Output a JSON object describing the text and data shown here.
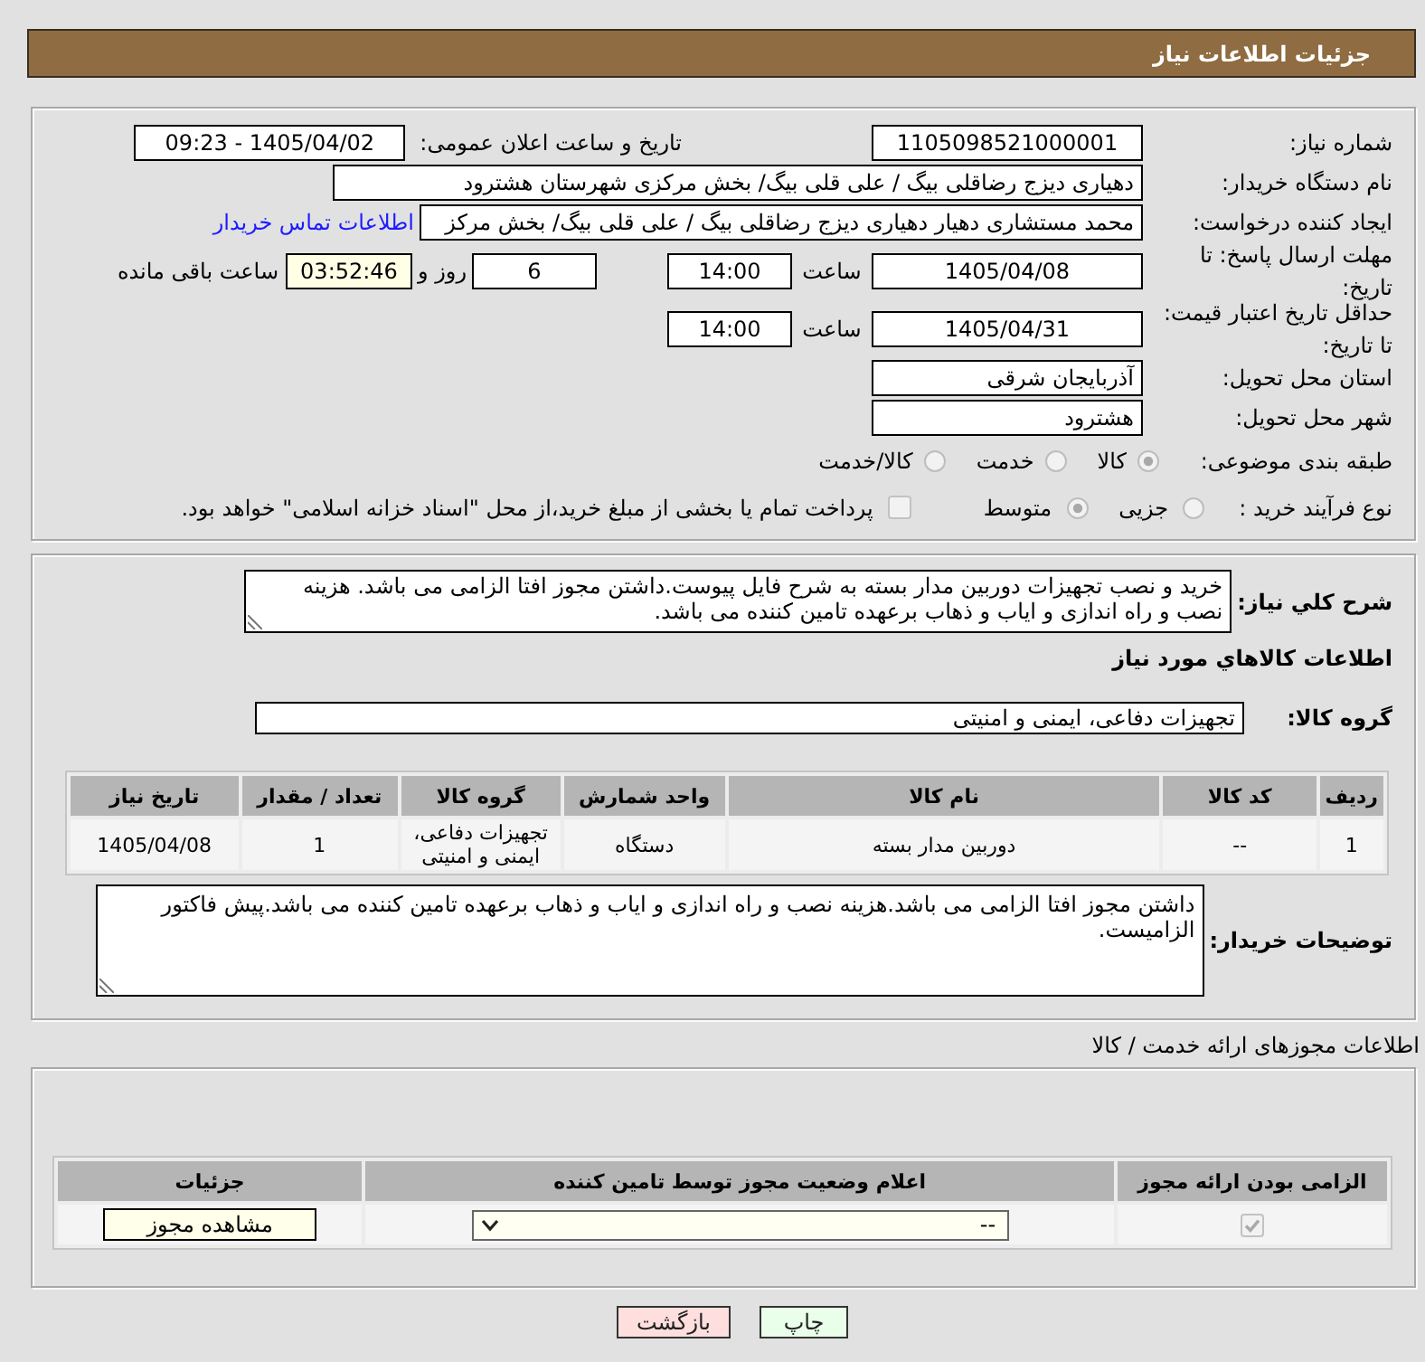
{
  "header": {
    "title": "جزئیات اطلاعات نیاز"
  },
  "need_info": {
    "need_number": {
      "label": "شماره نیاز:",
      "value": "1105098521000001"
    },
    "announcement": {
      "label": "تاریخ و ساعت اعلان عمومی:",
      "value": "1405/04/02 - 09:23"
    },
    "buyer_org": {
      "label": "نام دستگاه خریدار:",
      "value": "دهیاری دیزج رضاقلی بیگ / علی قلی بیگ/ بخش مرکزی شهرستان هشترود"
    },
    "requester": {
      "label": "ایجاد کننده درخواست:",
      "value": "محمد مستشاری دهیار دهیاری دیزج رضاقلی بیگ / علی قلی بیگ/ بخش مرکز",
      "link": "اطلاعات تماس خریدار"
    },
    "response_deadline": {
      "label": "مهلت ارسال پاسخ: تا تاریخ:",
      "date": "1405/04/08",
      "time_label": "ساعت",
      "time": "14:00",
      "days": "6",
      "days_label": "روز و",
      "remaining": "03:52:46",
      "remaining_label": "ساعت باقی مانده"
    },
    "price_validity": {
      "label": "حداقل تاریخ اعتبار قیمت: تا تاریخ:",
      "date": "1405/04/31",
      "time_label": "ساعت",
      "time": "14:00"
    },
    "delivery_province": {
      "label": "استان محل تحویل:",
      "value": "آذربایجان شرقی"
    },
    "delivery_city": {
      "label": "شهر محل تحویل:",
      "value": "هشترود"
    },
    "category": {
      "label": "طبقه بندی موضوعی:",
      "options": [
        {
          "label": "کالا",
          "selected": true,
          "disabled": true
        },
        {
          "label": "خدمت",
          "selected": false,
          "disabled": true
        },
        {
          "label": "کالا/خدمت",
          "selected": false,
          "disabled": true
        }
      ]
    },
    "purchase_process": {
      "label": "نوع فرآیند خرید :",
      "options": [
        {
          "label": "جزیی",
          "selected": false,
          "disabled": true
        },
        {
          "label": "متوسط",
          "selected": true,
          "disabled": true
        }
      ],
      "treasury_option": {
        "label": "پرداخت تمام یا بخشی از مبلغ خرید،از محل \"اسناد خزانه اسلامی\" خواهد بود.",
        "checked": false,
        "disabled": true
      }
    }
  },
  "goods": {
    "description": {
      "label": "شرح کلي نیاز:",
      "value": "خرید و نصب تجهیزات دوربین مدار بسته به شرح فایل پیوست.داشتن مجوز افتا الزامی می باشد. هزینه نصب و راه اندازی و ایاب و ذهاب برعهده تامین کننده می باشد."
    },
    "title": "اطلاعات کالاهاي مورد نیاز",
    "group": {
      "label": "گروه کالا:",
      "value": "تجهیزات دفاعی، ایمنی و امنیتی"
    },
    "table": {
      "columns": [
        "ردیف",
        "کد کالا",
        "نام کالا",
        "واحد شمارش",
        "گروه کالا",
        "تعداد / مقدار",
        "تاریخ نیاز"
      ],
      "rows": [
        [
          "1",
          "--",
          "دوربین مدار بسته",
          "دستگاه",
          "تجهیزات دفاعی، ایمنی و امنیتی",
          "1",
          "1405/04/08"
        ]
      ]
    },
    "buyer_notes": {
      "label": "توضیحات خریدار:",
      "value": "داشتن مجوز افتا الزامی می باشد.هزینه نصب و راه اندازی و ایاب و ذهاب برعهده تامین کننده می باشد.پیش فاکتور الزامیست."
    }
  },
  "permits": {
    "title": "اطلاعات مجوزهای ارائه خدمت / کالا",
    "columns": [
      "الزامی بودن ارائه مجوز",
      "اعلام وضعیت مجوز توسط تامین کننده",
      "جزئیات"
    ],
    "rows": [
      {
        "required": {
          "checked": true,
          "disabled": true
        },
        "status": "--",
        "details_button": "مشاهده مجوز"
      }
    ]
  },
  "buttons": [
    {
      "label": "چاپ",
      "kind": "print"
    },
    {
      "label": "بازگشت",
      "kind": "back"
    }
  ]
}
